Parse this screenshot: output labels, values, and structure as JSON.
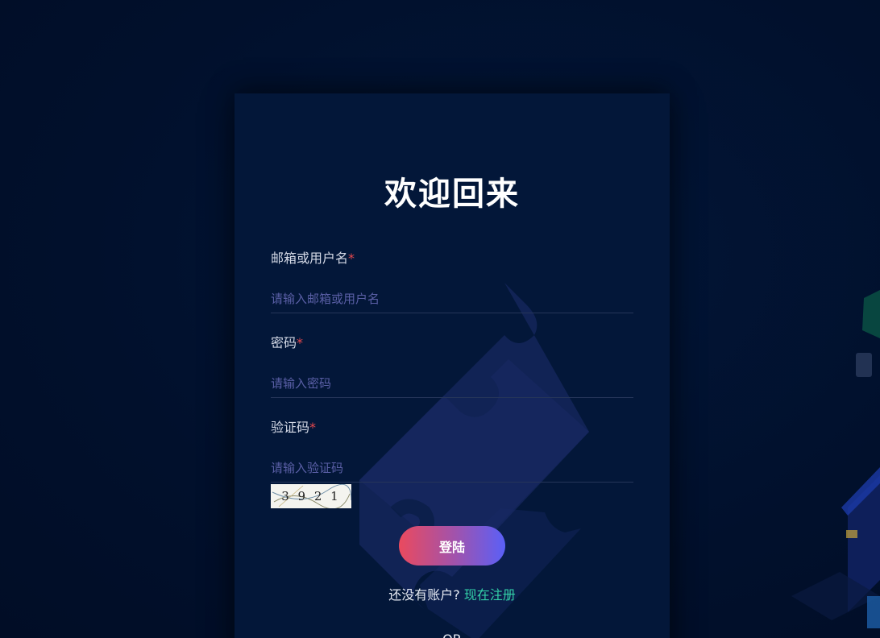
{
  "login": {
    "title": "欢迎回来",
    "username": {
      "label": "邮箱或用户名",
      "required_mark": "*",
      "placeholder": "请输入邮箱或用户名",
      "value": ""
    },
    "password": {
      "label": "密码",
      "required_mark": "*",
      "placeholder": "请输入密码",
      "value": ""
    },
    "captcha": {
      "label": "验证码",
      "required_mark": "*",
      "placeholder": "请输入验证码",
      "value": "",
      "image_text": "3 9 2 1"
    },
    "submit_label": "登陆",
    "register_prompt": "还没有账户? ",
    "register_link": "现在注册",
    "or_text": "OR"
  },
  "colors": {
    "background": "#01122f",
    "card": "#031739",
    "accent_link": "#33d1a8",
    "required": "#e5484d",
    "button_start": "#ea4a5e",
    "button_end": "#5a60f7"
  }
}
